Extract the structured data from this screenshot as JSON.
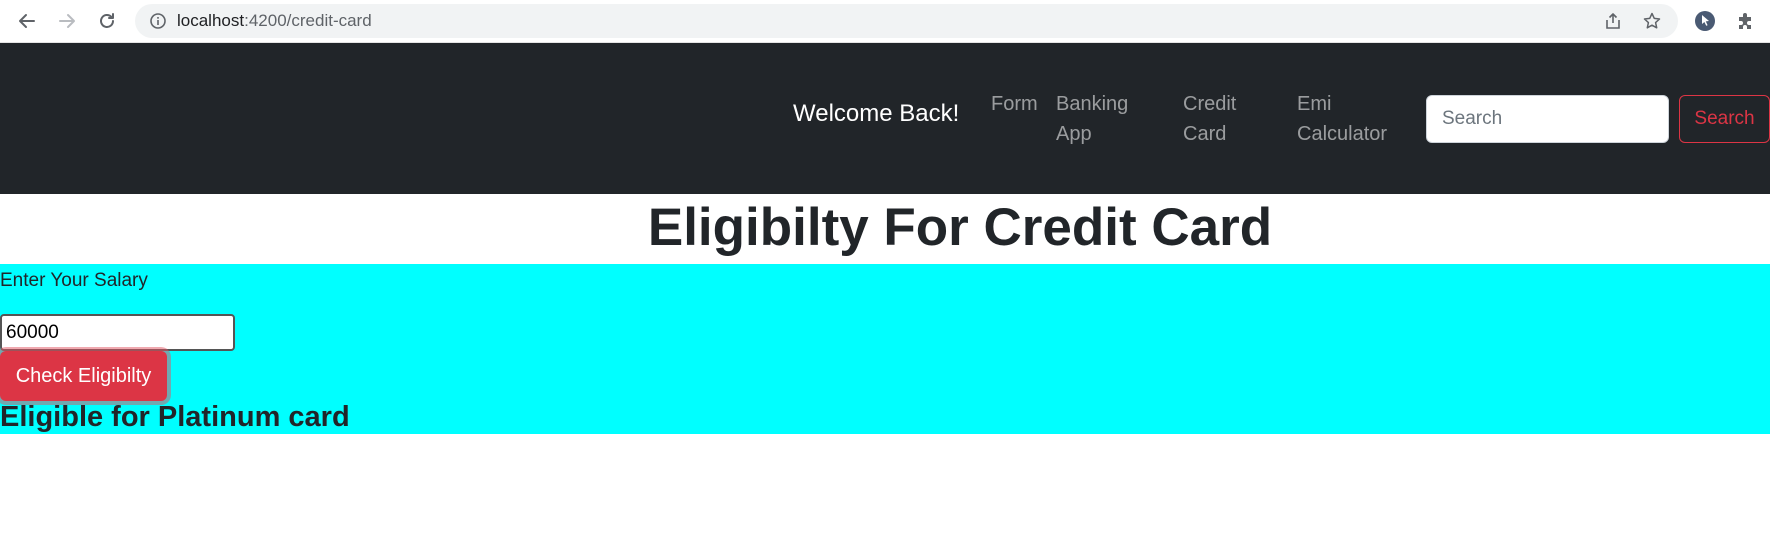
{
  "browser": {
    "url_host": "localhost",
    "url_path": ":4200/credit-card"
  },
  "navbar": {
    "brand": "Welcome Back!",
    "links": [
      "Form",
      "Banking App",
      "Credit Card",
      "Emi Calculator"
    ],
    "search": {
      "placeholder": "Search",
      "button_label": "Search"
    },
    "colors": {
      "background": "#212529",
      "search_button": "#dc3545"
    }
  },
  "main": {
    "title": "Eligibilty For Credit Card",
    "salary_label": "Enter Your Salary",
    "salary_value": "60000",
    "check_button_label": "Check Eligibilty",
    "result": "Eligible for Platinum card",
    "colors": {
      "panel": "#00ffff",
      "button": "#dc3545"
    }
  }
}
